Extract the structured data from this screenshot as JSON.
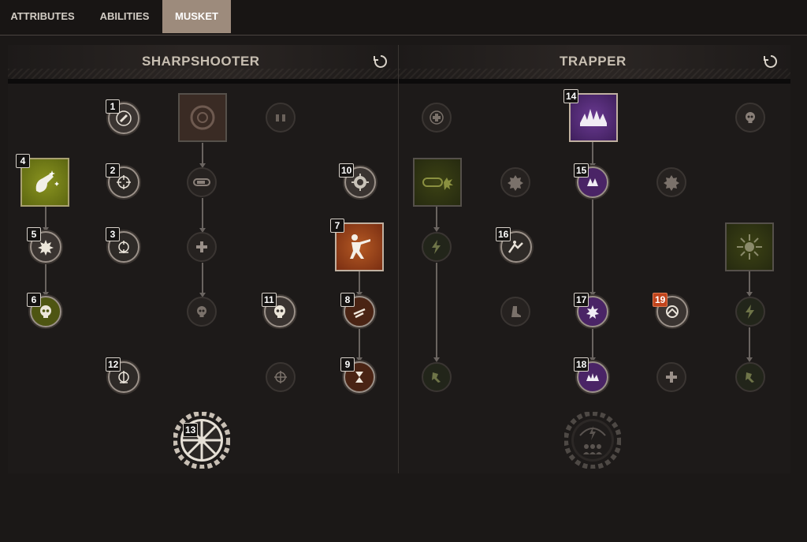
{
  "tabs": [
    {
      "label": "ATTRIBUTES",
      "active": false
    },
    {
      "label": "ABILITIES",
      "active": false
    },
    {
      "label": "MUSKET",
      "active": true
    }
  ],
  "trees": {
    "left": {
      "title": "SHARPSHOOTER"
    },
    "right": {
      "title": "TRAPPER"
    }
  },
  "badges": {
    "b1": "1",
    "b2": "2",
    "b3": "3",
    "b4": "4",
    "b5": "5",
    "b6": "6",
    "b7": "7",
    "b8": "8",
    "b9": "9",
    "b10": "10",
    "b11": "11",
    "b12": "12",
    "b13": "13",
    "b14": "14",
    "b15": "15",
    "b16": "16",
    "b17": "17",
    "b18": "18",
    "b19": "19"
  },
  "colors": {
    "accent_tab": "#9d8b7c",
    "green_skill": "#6f7a12",
    "orange_skill": "#8a3a1a",
    "purple_skill": "#5a2d7c",
    "hot_badge": "#c1441c"
  }
}
